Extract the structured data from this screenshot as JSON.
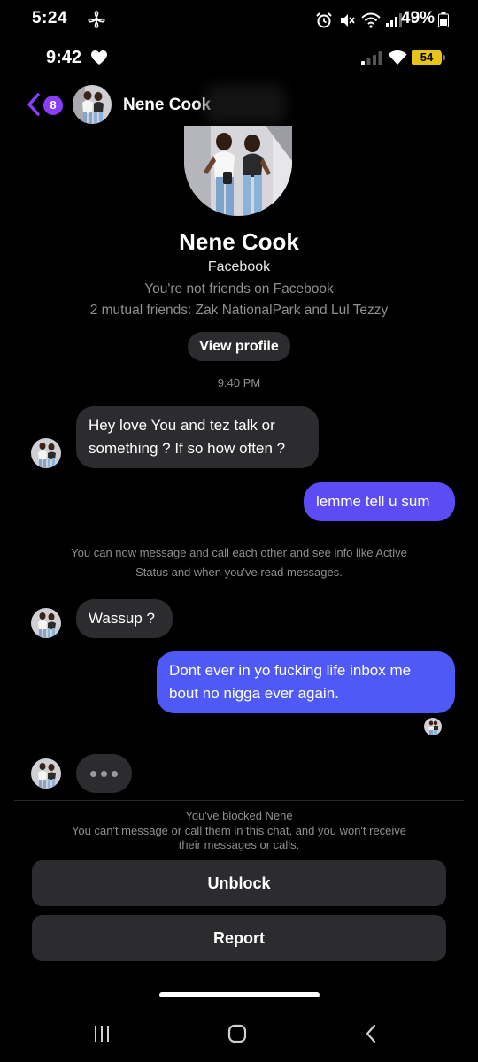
{
  "system_status": {
    "time": "5:24",
    "battery": "49%"
  },
  "inner_status": {
    "time": "9:42",
    "battery": "54"
  },
  "header": {
    "back_count": "8",
    "contact_name": "Nene Cook"
  },
  "profile": {
    "name": "Nene Cook",
    "platform": "Facebook",
    "friend_status": "You're not friends on Facebook",
    "mutual_friends": "2 mutual friends: Zak NationalPark and Lul Tezzy",
    "view_profile_label": "View profile"
  },
  "conversation": {
    "timestamp": "9:40 PM",
    "messages": [
      {
        "direction": "in",
        "lines": [
          "Hey love You and tez talk or",
          "something ? If so how often ?"
        ]
      },
      {
        "direction": "out",
        "text": "lemme tell u sum"
      },
      {
        "direction": "in",
        "text": "Wassup ?"
      },
      {
        "direction": "out",
        "lines": [
          "Dont ever in yo fucking life inbox me",
          "bout no nigga ever again."
        ]
      }
    ],
    "system_notice": [
      "You can now message and call each other and see info like Active",
      "Status and when you've read messages."
    ]
  },
  "blocked": {
    "title": "You've blocked Nene",
    "description": [
      "You can't message or call them in this chat, and you won't receive",
      "their messages or calls."
    ],
    "unblock_label": "Unblock",
    "report_label": "Report"
  },
  "colors": {
    "outgoing_bubble": "#5c4cf5",
    "incoming_bubble": "#2c2c2e",
    "accent": "#8a3dff"
  }
}
